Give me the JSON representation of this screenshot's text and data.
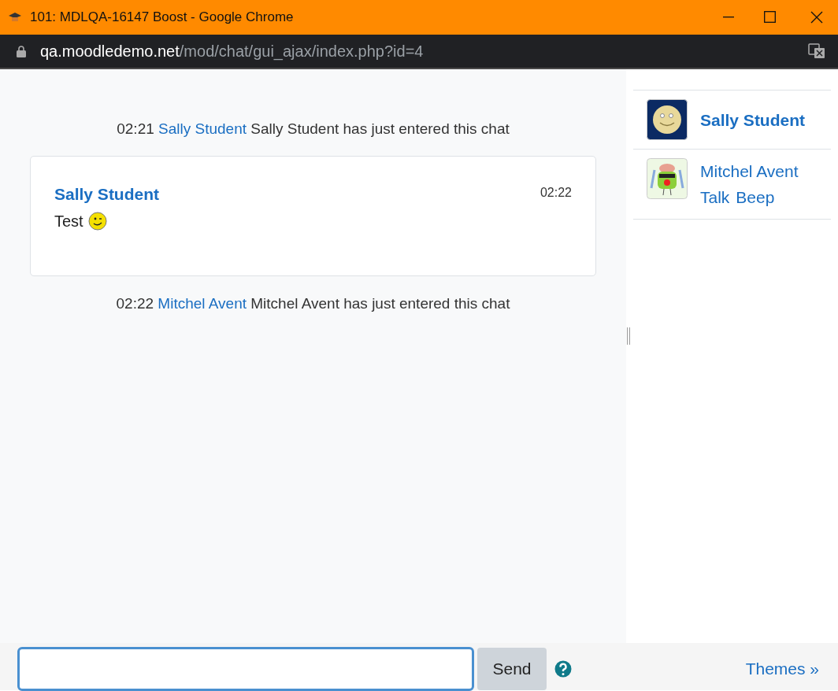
{
  "window": {
    "title": "101: MDLQA-16147 Boost - Google Chrome"
  },
  "address": {
    "host": "qa.moodledemo.net",
    "path": "/mod/chat/gui_ajax/index.php?id=4"
  },
  "messages": [
    {
      "kind": "event",
      "time": "02:21",
      "user": "Sally Student",
      "text": "Sally Student has just entered this chat"
    },
    {
      "kind": "message",
      "time": "02:22",
      "user": "Sally Student",
      "text": "Test"
    },
    {
      "kind": "event",
      "time": "02:22",
      "user": "Mitchel Avent",
      "text": "Mitchel Avent has just entered this chat"
    }
  ],
  "users": [
    {
      "kind": "moon",
      "name": "Sally Student",
      "is_self": true
    },
    {
      "kind": "monster",
      "name": "Mitchel Avent",
      "is_self": false,
      "actions": [
        "Talk",
        "Beep"
      ]
    }
  ],
  "composer": {
    "button": "Send",
    "themes_link": "Themes »"
  }
}
